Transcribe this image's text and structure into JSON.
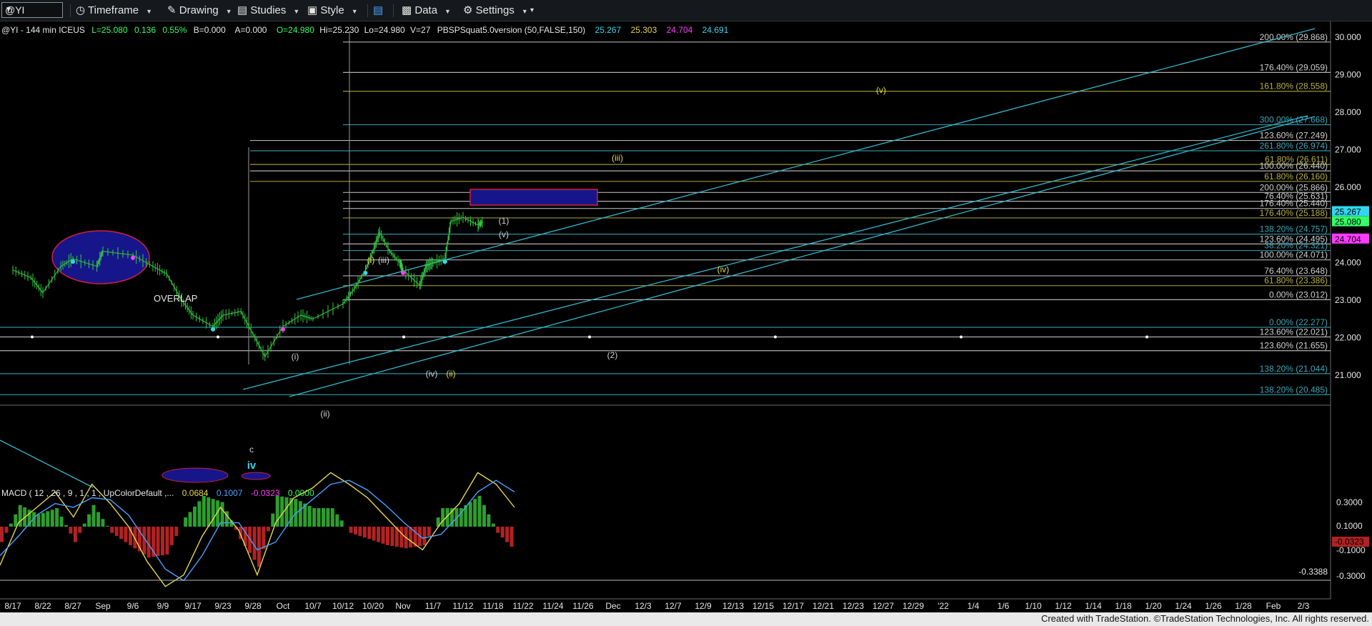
{
  "toolbar": {
    "symbol": "@YI",
    "timeframe": "Timeframe",
    "drawing": "Drawing",
    "studies": "Studies",
    "style": "Style",
    "data": "Data",
    "settings": "Settings"
  },
  "header": {
    "symbol_line": "@YI - 144 min  ICEUS",
    "last": "L=25.080",
    "change": "0.136",
    "pct": "0.55%",
    "bid": "B=0.000",
    "ask": "A=0.000",
    "open": "O=24.980",
    "hi": "Hi=25.230",
    "lo": "Lo=24.980",
    "vol": "V=27",
    "study": "PBSPSquat5.0version (50,FALSE,150)",
    "v1": "25.267",
    "v2": "25.303",
    "v3": "24.704",
    "v4": "24.691"
  },
  "macd_header": {
    "label": "MACD ( 12 , 26 , 9 , 1 , 1 , UpColorDefault ,...",
    "v1": "0.0684",
    "v2": "0.1007",
    "v3": "-0.0323",
    "v4": "0.0000"
  },
  "colors": {
    "accent_cyan": "#33d6ee",
    "label_yellow": "#e8d84a",
    "magenta": "#ff3cff",
    "price_green": "#33ff66",
    "hist_green": "#2e9d2e",
    "hist_red": "#b22222",
    "ellipse_fill": "#1a1a8c",
    "ellipse_stroke": "#d02040"
  },
  "chart_data": {
    "type": "line",
    "title": "",
    "price_axis": {
      "ticks": [
        "30.000",
        "29.000",
        "28.000",
        "27.000",
        "26.000",
        "24.000",
        "23.000",
        "22.000",
        "21.000"
      ],
      "ylim": [
        20.3,
        30.15
      ]
    },
    "date_ticks": [
      "8/17",
      "8/22",
      "8/27",
      "Sep",
      "9/6",
      "9/9",
      "9/17",
      "9/23",
      "9/28",
      "Oct",
      "10/7",
      "10/12",
      "10/20",
      "Nov",
      "11/7",
      "11/12",
      "11/18",
      "11/22",
      "11/24",
      "11/26",
      "Dec",
      "12/3",
      "12/7",
      "12/9",
      "12/13",
      "12/15",
      "12/17",
      "12/21",
      "12/23",
      "12/27",
      "12/29",
      "'22",
      "1/4",
      "1/6",
      "1/10",
      "1/12",
      "1/14",
      "1/18",
      "1/20",
      "1/24",
      "1/26",
      "1/28",
      "Feb",
      "2/3"
    ],
    "price_series": [
      {
        "x": "8/17",
        "y": 23.8
      },
      {
        "x": "8/20",
        "y": 23.6
      },
      {
        "x": "8/22",
        "y": 23.2
      },
      {
        "x": "8/25",
        "y": 23.9
      },
      {
        "x": "8/27",
        "y": 24.1
      },
      {
        "x": "8/31",
        "y": 23.9
      },
      {
        "x": "Sep",
        "y": 24.3
      },
      {
        "x": "9/6",
        "y": 24.2
      },
      {
        "x": "9/8",
        "y": 23.9
      },
      {
        "x": "9/10",
        "y": 23.7
      },
      {
        "x": "9/14",
        "y": 23.0
      },
      {
        "x": "9/17",
        "y": 22.6
      },
      {
        "x": "9/21",
        "y": 22.3
      },
      {
        "x": "9/23",
        "y": 22.6
      },
      {
        "x": "9/26",
        "y": 22.7
      },
      {
        "x": "9/28",
        "y": 22.1
      },
      {
        "x": "9/30",
        "y": 21.5
      },
      {
        "x": "Oct",
        "y": 22.3
      },
      {
        "x": "10/5",
        "y": 22.6
      },
      {
        "x": "10/7",
        "y": 22.5
      },
      {
        "x": "10/12",
        "y": 22.9
      },
      {
        "x": "10/15",
        "y": 23.3
      },
      {
        "x": "10/18",
        "y": 23.8
      },
      {
        "x": "10/20",
        "y": 24.3
      },
      {
        "x": "10/22",
        "y": 24.8
      },
      {
        "x": "10/25",
        "y": 24.3
      },
      {
        "x": "10/28",
        "y": 24.0
      },
      {
        "x": "Nov",
        "y": 23.8
      },
      {
        "x": "11/3",
        "y": 23.4
      },
      {
        "x": "11/5",
        "y": 23.9
      },
      {
        "x": "11/7",
        "y": 24.0
      },
      {
        "x": "11/9",
        "y": 24.1
      },
      {
        "x": "11/10",
        "y": 25.1
      },
      {
        "x": "11/12",
        "y": 25.2
      },
      {
        "x": "11/15",
        "y": 25.0
      },
      {
        "x": "11/16",
        "y": 25.08
      }
    ],
    "fib_levels": [
      {
        "label": "200.00% (29.868)",
        "y": 29.868,
        "color": "#cfcfcf"
      },
      {
        "label": "176.40% (29.059)",
        "y": 29.059,
        "color": "#cfcfcf"
      },
      {
        "label": "161.80% (28.558)",
        "y": 28.558,
        "color": "#b8b040"
      },
      {
        "label": "300.00% (27.668)",
        "y": 27.668,
        "color": "#3aa8b8"
      },
      {
        "label": "123.60% (27.249)",
        "y": 27.249,
        "color": "#cfcfcf"
      },
      {
        "label": "261.80% (26.974)",
        "y": 26.974,
        "color": "#3aa8b8"
      },
      {
        "label": "61.80% (26.611)",
        "y": 26.611,
        "color": "#b8b040"
      },
      {
        "label": "100.00% (26.440)",
        "y": 26.44,
        "color": "#cfcfcf"
      },
      {
        "label": "61.80% (26.160)",
        "y": 26.16,
        "color": "#b8b040"
      },
      {
        "label": "200.00% (25.866)",
        "y": 25.866,
        "color": "#cfcfcf"
      },
      {
        "label": "76.40% (25.631)",
        "y": 25.631,
        "color": "#cfcfcf"
      },
      {
        "label": "176.40% (25.440)",
        "y": 25.44,
        "color": "#cfcfcf"
      },
      {
        "label": "176.40% (25.188)",
        "y": 25.188,
        "color": "#b8b040"
      },
      {
        "label": "138.20% (24.757)",
        "y": 24.757,
        "color": "#3aa8b8"
      },
      {
        "label": "123.60% (24.495)",
        "y": 24.495,
        "color": "#cfcfcf"
      },
      {
        "label": "38.20% (24.321)",
        "y": 24.321,
        "color": "#3aa8b8"
      },
      {
        "label": "100.00% (24.071)",
        "y": 24.071,
        "color": "#cfcfcf"
      },
      {
        "label": "76.40% (23.648)",
        "y": 23.648,
        "color": "#cfcfcf"
      },
      {
        "label": "61.80% (23.386)",
        "y": 23.386,
        "color": "#b8b040"
      },
      {
        "label": "0.00% (23.012)",
        "y": 23.012,
        "color": "#cfcfcf"
      },
      {
        "label": "0.00% (22.277)",
        "y": 22.277,
        "color": "#3aa8b8"
      },
      {
        "label": "123.60% (22.021)",
        "y": 22.021,
        "color": "#cfcfcf"
      },
      {
        "label": "123.60% (21.655)",
        "y": 21.655,
        "color": "#cfcfcf"
      },
      {
        "label": "138.20% (21.044)",
        "y": 21.044,
        "color": "#3aa8b8"
      },
      {
        "label": "138.20% (20.485)",
        "y": 20.485,
        "color": "#3aa8b8"
      }
    ],
    "wave_labels": [
      {
        "text": "(v)",
        "x": "1/4",
        "y": 28.95,
        "color": "#e8d84a"
      },
      {
        "text": "(iii)",
        "x": "11/24",
        "y": 27.8,
        "color": "#e8d84a"
      },
      {
        "text": "(1)",
        "x": "11/13",
        "y": 26.2,
        "color": "#cfcfcf"
      },
      {
        "text": "(v)",
        "x": "11/13",
        "y": 25.9,
        "color": "#cfcfcf"
      },
      {
        "text": "(iv)",
        "x": "12/9",
        "y": 24.9,
        "color": "#e8d84a"
      },
      {
        "text": "(i)",
        "x": "10/20",
        "y": 25.0,
        "color": "#e8d84a"
      },
      {
        "text": "(iii)",
        "x": "10/22",
        "y": 25.0,
        "color": "#cfcfcf"
      },
      {
        "text": "(2)",
        "x": "11/22",
        "y": 23.1,
        "color": "#cfcfcf"
      },
      {
        "text": "(iv)",
        "x": "11/3",
        "y": 22.6,
        "color": "#cfcfcf"
      },
      {
        "text": "(ii)",
        "x": "11/7",
        "y": 22.6,
        "color": "#e8d84a"
      },
      {
        "text": "(i)",
        "x": "10/7",
        "y": 23.1,
        "color": "#cfcfcf"
      },
      {
        "text": "(ii)",
        "x": "10/12",
        "y": 21.9,
        "color": "#cfcfcf"
      },
      {
        "text": "c",
        "x": "9/30",
        "y": 21.25,
        "color": "#cfcfcf"
      },
      {
        "text": "iv",
        "x": "9/30",
        "y": 20.9,
        "color": "#33d6ee"
      }
    ],
    "annotations": [
      "OVERLAP"
    ],
    "price_tags": [
      {
        "value": "25.267",
        "bg": "#33d6ee"
      },
      {
        "value": "25.080",
        "bg": "#33ff66"
      },
      {
        "value": "24.704",
        "bg": "#ff3cff"
      }
    ],
    "macd": {
      "ticks": [
        "0.3000",
        "0.1000",
        "-0.1000",
        "-0.3000"
      ],
      "min_label": "-0.3388",
      "value_tag": "-0.0323",
      "macd_line": [
        -0.2,
        0.02,
        0.1,
        0.18,
        0.05,
        0.22,
        0.12,
        0.0,
        -0.18,
        -0.31,
        -0.25,
        -0.05,
        0.1,
        -0.02,
        -0.25,
        0.02,
        0.15,
        0.2,
        0.28,
        0.22,
        0.15,
        0.05,
        -0.05,
        -0.12,
        0.02,
        0.12,
        0.28,
        0.22,
        0.1
      ],
      "signal_line": [
        -0.15,
        -0.05,
        0.06,
        0.12,
        0.1,
        0.15,
        0.14,
        0.06,
        -0.08,
        -0.22,
        -0.28,
        -0.15,
        0.02,
        0.02,
        -0.12,
        -0.08,
        0.06,
        0.14,
        0.22,
        0.24,
        0.19,
        0.11,
        0.02,
        -0.06,
        -0.04,
        0.06,
        0.18,
        0.24,
        0.18
      ]
    }
  },
  "footer": {
    "credit": "Created with TradeStation. ©TradeStation Technologies, Inc. All rights reserved."
  }
}
